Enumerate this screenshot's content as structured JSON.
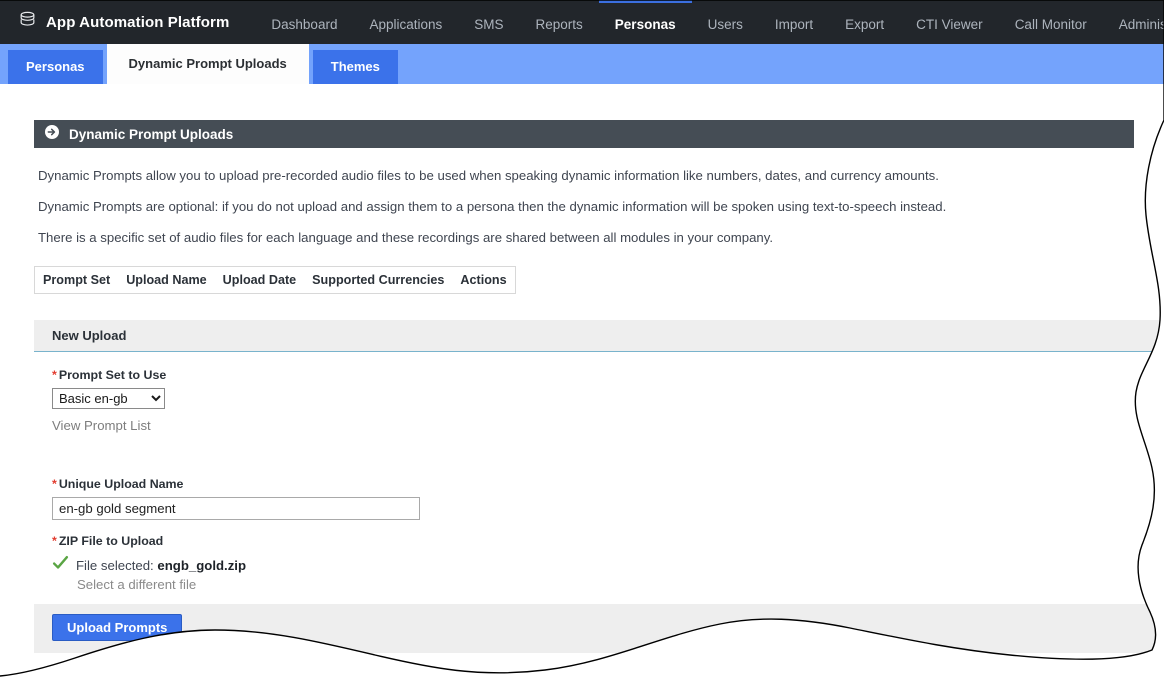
{
  "topnav": {
    "logo_icon": "database-stack-icon",
    "brand": "App Automation Platform",
    "items": [
      {
        "label": "Dashboard",
        "active": false
      },
      {
        "label": "Applications",
        "active": false
      },
      {
        "label": "SMS",
        "active": false
      },
      {
        "label": "Reports",
        "active": false
      },
      {
        "label": "Personas",
        "active": true
      },
      {
        "label": "Users",
        "active": false
      },
      {
        "label": "Import",
        "active": false
      },
      {
        "label": "Export",
        "active": false
      },
      {
        "label": "CTI Viewer",
        "active": false
      },
      {
        "label": "Call Monitor",
        "active": false
      },
      {
        "label": "Administration",
        "active": false
      }
    ]
  },
  "tabs": [
    {
      "label": "Personas",
      "active": false
    },
    {
      "label": "Dynamic Prompt Uploads",
      "active": true
    },
    {
      "label": "Themes",
      "active": false
    }
  ],
  "banner": {
    "icon": "arrow-right-circle-icon",
    "title": "Dynamic Prompt Uploads"
  },
  "paragraphs": [
    "Dynamic Prompts allow you to upload pre-recorded audio files to be used when speaking dynamic information like numbers, dates, and currency amounts.",
    "Dynamic Prompts are optional: if you do not upload and assign them to a persona then the dynamic information will be spoken using text-to-speech instead.",
    "There is a specific set of audio files for each language and these recordings are shared between all modules in your company."
  ],
  "uploads_table": {
    "columns": [
      "Prompt Set",
      "Upload Name",
      "Upload Date",
      "Supported Currencies",
      "Actions"
    ],
    "rows": []
  },
  "new_upload": {
    "section_title": "New Upload",
    "prompt_set": {
      "label": "Prompt Set to Use",
      "required_marker": "*",
      "value": "Basic en-gb",
      "options": [
        "Basic en-gb"
      ],
      "view_list_link": "View Prompt List"
    },
    "upload_name": {
      "label": "Unique Upload Name",
      "required_marker": "*",
      "value": "en-gb gold segment",
      "placeholder": ""
    },
    "zip_file": {
      "label": "ZIP File to Upload",
      "required_marker": "*",
      "status_icon": "green-check-icon",
      "status_prefix": "File selected:",
      "file_name": "engb_gold.zip",
      "change_link": "Select a different file"
    },
    "submit_button": "Upload Prompts"
  },
  "colors": {
    "topnav_bg": "#22262b",
    "tabstrip_bg": "#74a3fc",
    "tab_inactive_bg": "#3b72ea",
    "banner_bg": "#454d55",
    "accent_blue": "#3b72ea",
    "panel_head_bg": "#eeeeee",
    "panel_head_border": "#79b3cc",
    "required_red": "#e23b2e",
    "check_green": "#5aa544"
  }
}
